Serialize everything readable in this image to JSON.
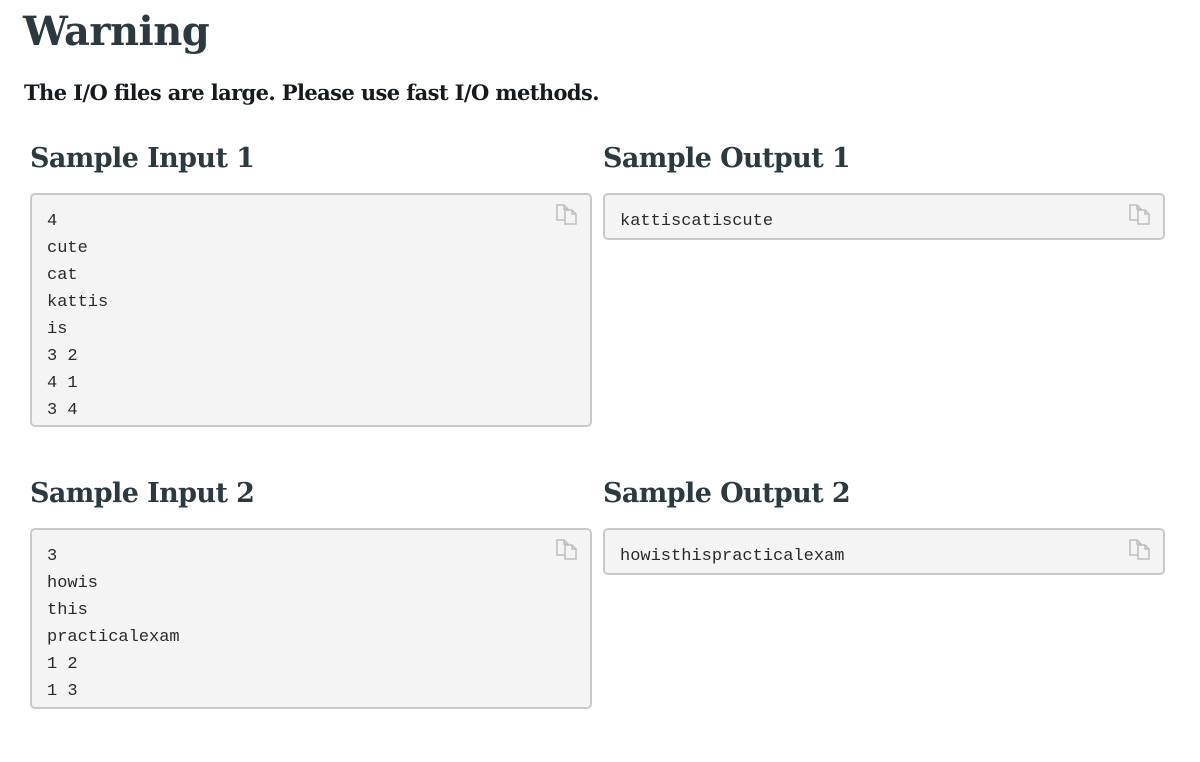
{
  "warning": {
    "heading": "Warning",
    "text": "The I/O files are large. Please use fast I/O methods."
  },
  "samples": [
    {
      "input_title": "Sample Input 1",
      "input": "4\ncute\ncat\nkattis\nis\n3 2\n4 1\n3 4",
      "output_title": "Sample Output 1",
      "output": "kattiscatiscute"
    },
    {
      "input_title": "Sample Input 2",
      "input": "3\nhowis\nthis\npracticalexam\n1 2\n1 3",
      "output_title": "Sample Output 2",
      "output": "howisthispracticalexam"
    }
  ],
  "icons": {
    "copy": "copy-icon"
  }
}
